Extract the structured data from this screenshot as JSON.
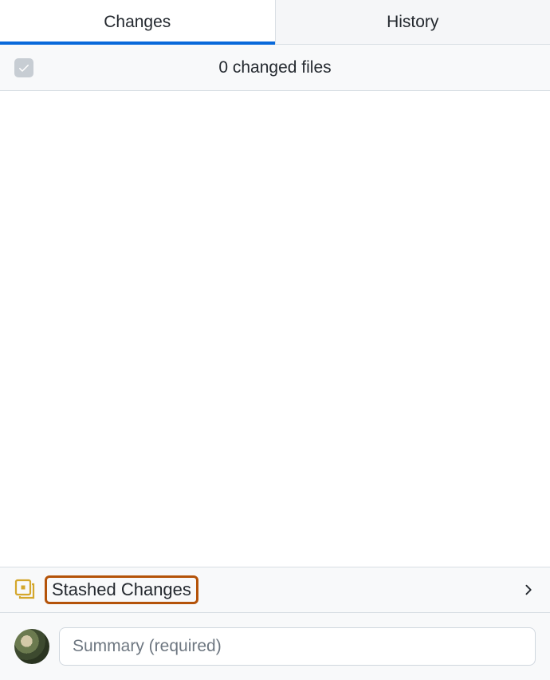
{
  "tabs": {
    "changes": "Changes",
    "history": "History"
  },
  "fileHeader": {
    "text": "0 changed files"
  },
  "stash": {
    "label": "Stashed Changes"
  },
  "commit": {
    "summaryPlaceholder": "Summary (required)"
  }
}
